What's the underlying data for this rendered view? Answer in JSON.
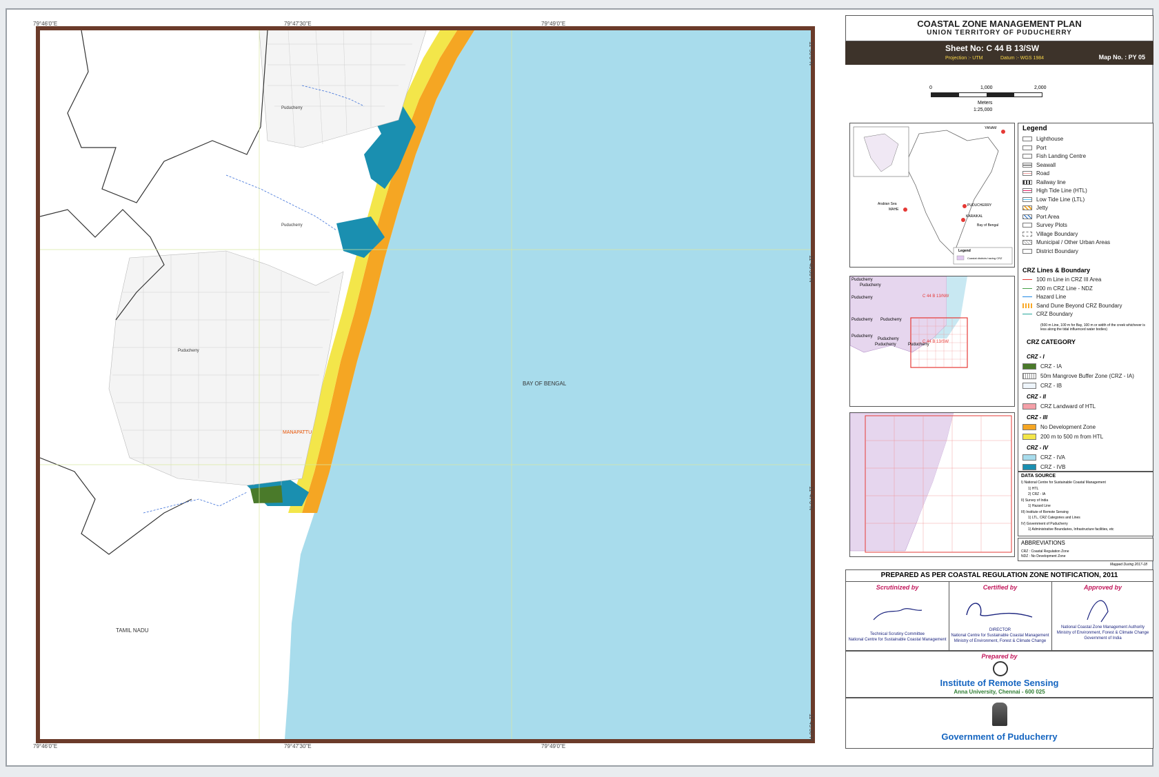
{
  "title": {
    "main": "COASTAL ZONE MANAGEMENT PLAN",
    "sub": "UNION TERRITORY OF PUDUCHERRY"
  },
  "sheet": {
    "number": "Sheet No: C 44 B 13/SW",
    "projection": "Projection :- UTM",
    "datum": "Datum :- WGS 1984",
    "map_no": "Map No. : PY 05"
  },
  "scale": {
    "ticks": [
      "0",
      "1,000",
      "2,000"
    ],
    "unit": "Meters",
    "ratio": "1:25,000"
  },
  "coords": {
    "top": [
      "79°46'0\"E",
      "79°47'30\"E",
      "79°49'0\"E"
    ],
    "bottom": [
      "79°46'0\"E",
      "79°47'30\"E",
      "79°49'0\"E"
    ],
    "right": [
      "11°50'0\"N",
      "11°48'30\"N",
      "11°47'0\"N",
      "11°45'30\"N"
    ]
  },
  "map_labels": {
    "sea": "BAY OF BENGAL",
    "state": "TAMIL NADU",
    "village_top": "Puducherry",
    "village_mid": "Puducherry",
    "village_low": "Puducherry",
    "coast_place": "MANAPATTU"
  },
  "inset_india": {
    "yanam": "YANAM",
    "puducherry": "PUDUCHERRY",
    "karaikal": "KARAIKAL",
    "mahe": "MAHE",
    "arabian": "Arabian Sea",
    "bay": "Bay of Bengal",
    "legend_title": "Legend",
    "legend_item": "Coastal districts having CRZ"
  },
  "inset_index": {
    "nw": "C 44 B 13/NW",
    "sw": "C 44 B 13/SW",
    "labels": [
      "Puducherry",
      "Puducherry",
      "Puducherry",
      "Puducherry",
      "Puducherry",
      "Puducherry",
      "Puducherry",
      "Puducherry",
      "Puducherry"
    ]
  },
  "legend": {
    "title": "Legend",
    "items": [
      {
        "label": "Lighthouse",
        "icon": "lighthouse-icon"
      },
      {
        "label": "Port",
        "icon": "anchor-icon"
      },
      {
        "label": "Fish Landing Centre",
        "icon": "fish-icon"
      },
      {
        "label": "Seawall",
        "icon": "seawall-line"
      },
      {
        "label": "Road",
        "icon": "road-line"
      },
      {
        "label": "Railway line",
        "icon": "railway-line"
      },
      {
        "label": "High Tide Line (HTL)",
        "icon": "htl-line"
      },
      {
        "label": "Low Tide Line (LTL)",
        "icon": "ltl-line"
      },
      {
        "label": "Jetty",
        "icon": "jetty-swatch"
      },
      {
        "label": "Port Area",
        "icon": "port-area-swatch"
      },
      {
        "label": "Survey Plots",
        "icon": "survey-plot-swatch"
      },
      {
        "label": "Village Boundary",
        "icon": "village-boundary-swatch"
      },
      {
        "label": "Municipal / Other Urban Areas",
        "icon": "urban-swatch"
      },
      {
        "label": "District Boundary",
        "icon": "district-boundary-swatch"
      }
    ],
    "crz_lines_title": "CRZ  Lines & Boundary",
    "crz_lines": [
      "100 m Line in CRZ III Area",
      "200 m CRZ Line - NDZ",
      "Hazard Line",
      "Sand Dune Beyond CRZ Boundary",
      "CRZ Boundary"
    ],
    "crz_note": "(500 m Line, 100 m for Bay, 100 m or width of the creek whichever is less along the tidal influenced water bodies)",
    "category_title": "CRZ CATEGORY",
    "crz1": "CRZ - I",
    "crz1_items": [
      "CRZ - IA",
      "50m Mangrove Buffer Zone (CRZ - IA)",
      "CRZ - IB"
    ],
    "crz2": "CRZ - II",
    "crz2_items": [
      "CRZ Landward of HTL"
    ],
    "crz3": "CRZ - III",
    "crz3_items": [
      "No Development Zone",
      "200 m to 500 m from HTL"
    ],
    "crz4": "CRZ - IV",
    "crz4_items": [
      "CRZ - IVA",
      "CRZ - IVB"
    ]
  },
  "colors": {
    "sea": "#a8dcec",
    "crz_ia": "#4a7a2a",
    "crz_ivb": "#1a8fb0",
    "ndz": "#f5a623",
    "crz_iii_200_500": "#f3e64a",
    "crz_ii": "#f4a0a8",
    "frame": "#6b3b2a"
  },
  "data_source": {
    "title": "DATA SOURCE",
    "lines": [
      "I) National Centre for Sustainable Coastal Management",
      "1) HTL",
      "2) CRZ - IA",
      "II) Survey of India",
      "1) Hazard Line",
      "III) Institute of Remote Sensing",
      "1) LTL, CRZ Categories and Lines",
      "IV) Government of Puducherry",
      "1) Administrative Boundaries, Infrastructure facilities, etc"
    ]
  },
  "abbreviations": {
    "title": "ABBREVIATIONS",
    "lines": [
      "CRZ   :  Coastal Regulation Zone",
      "NDZ   :  No Development Zone"
    ],
    "mapped": "Mapped During 2017-18"
  },
  "prepared": {
    "heading": "PREPARED AS PER COASTAL REGULATION ZONE NOTIFICATION, 2011",
    "scrutinized": "Scrutinized by",
    "certified": "Certified by",
    "approved": "Approved by",
    "scr_text1": "Technical Scrutiny Committee",
    "scr_text2": "National Centre for Sustainable Coastal Management",
    "cert_text0": "DIRECTOR",
    "cert_text1": "National Centre for Sustainable Coastal Management",
    "cert_text2": "Ministry of Environment, Forest & Climate Change",
    "appr_text1": "National Coastal Zone Management Authority",
    "appr_text2": "Ministry of Environment, Forest & Climate Change",
    "appr_text3": "Government of India",
    "prepared_by": "Prepared by",
    "institute": "Institute of Remote Sensing",
    "university": "Anna University, Chennai - 600 025",
    "govt": "Government of Puducherry"
  }
}
